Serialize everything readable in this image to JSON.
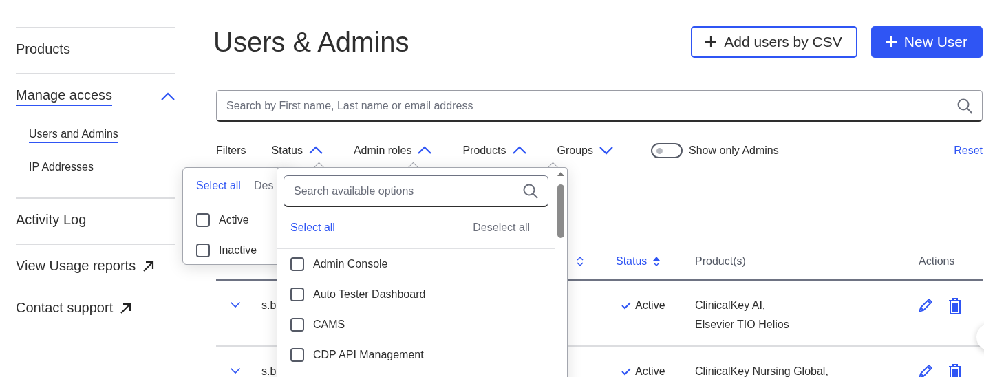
{
  "sidebar": {
    "items": [
      {
        "kind": "section",
        "label": "Products",
        "selected": false
      },
      {
        "kind": "group",
        "label": "Manage access",
        "selected": true,
        "expanded": true,
        "children": [
          {
            "label": "Users and Admins",
            "selected": true
          },
          {
            "label": "IP Addresses",
            "selected": false
          }
        ]
      },
      {
        "kind": "section",
        "label": "Activity Log",
        "selected": false
      },
      {
        "kind": "external",
        "label": "View Usage reports"
      },
      {
        "kind": "external",
        "label": "Contact support"
      }
    ]
  },
  "page": {
    "title": "Users & Admins",
    "buttons": [
      {
        "kind": "outline",
        "label": "Add users by CSV"
      },
      {
        "kind": "primary",
        "label": "New User"
      }
    ]
  },
  "search": {
    "placeholder": "Search by First name, Last name or email address"
  },
  "filters": {
    "label": "Filters",
    "items": [
      {
        "label": "Status",
        "expanded": true
      },
      {
        "label": "Admin roles",
        "expanded": true
      },
      {
        "label": "Products",
        "expanded": true
      },
      {
        "label": "Groups",
        "expanded": false
      }
    ],
    "admins_toggle": {
      "label": "Show only Admins",
      "on": false
    },
    "reset": "Reset"
  },
  "table": {
    "columns": [
      {
        "sortable": true,
        "sorted": false
      },
      {
        "label": "Status",
        "sortable": true,
        "sorted": true
      },
      {
        "label": "Product(s)",
        "sortable": false,
        "sorted": false
      },
      {
        "label": "Actions",
        "sortable": false,
        "sorted": false
      }
    ],
    "rows": [
      {
        "email": "s.b",
        "status": "Active",
        "products": [
          "ClinicalKey AI,",
          "Elsevier TIO Helios"
        ]
      },
      {
        "email": "s.b",
        "status": "Active",
        "products": [
          "ClinicalKey Nursing Global,"
        ]
      }
    ]
  },
  "status_menu": {
    "select_all": "Select all",
    "deselect_all": "Des",
    "options": [
      {
        "label": "Active",
        "checked": false
      },
      {
        "label": "Inactive",
        "checked": false
      }
    ]
  },
  "products_menu": {
    "placeholder": "Search available options",
    "select_all": "Select all",
    "deselect_all": "Deselect all",
    "options": [
      {
        "label": "Admin Console",
        "checked": false
      },
      {
        "label": "Auto Tester Dashboard",
        "checked": false
      },
      {
        "label": "CAMS",
        "checked": false
      },
      {
        "label": "CDP API Management",
        "checked": false
      }
    ]
  }
}
